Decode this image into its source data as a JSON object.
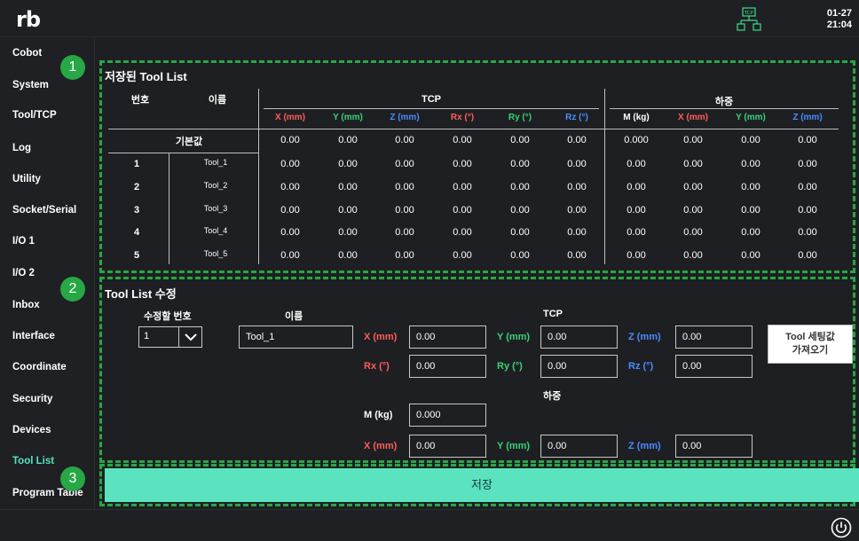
{
  "header": {
    "logo": "rb",
    "date": "01-27",
    "time": "21:04",
    "tcp_icon_label": "TCP"
  },
  "sidebar": {
    "items": [
      {
        "label": "Cobot"
      },
      {
        "label": "System"
      },
      {
        "label": "Tool/TCP"
      },
      {
        "label": "Log"
      },
      {
        "label": "Utility"
      },
      {
        "label": "Socket/Serial"
      },
      {
        "label": "I/O 1"
      },
      {
        "label": "I/O 2"
      },
      {
        "label": "Inbox"
      },
      {
        "label": "Interface"
      },
      {
        "label": "Coordinate"
      },
      {
        "label": "Security"
      },
      {
        "label": "Devices"
      },
      {
        "label": "Tool List",
        "active": true
      },
      {
        "label": "Program Table"
      }
    ]
  },
  "badges": [
    "1",
    "2",
    "3"
  ],
  "saved_list": {
    "title": "저장된 Tool List",
    "col_number": "번호",
    "col_name": "이름",
    "group_tcp": "TCP",
    "group_payload": "하중",
    "tcp_cols": [
      "X (mm)",
      "Y (mm)",
      "Z (mm)",
      "Rx (°)",
      "Ry (°)",
      "Rz (°)"
    ],
    "payload_cols": [
      "M (kg)",
      "X (mm)",
      "Y (mm)",
      "Z (mm)"
    ],
    "default_label": "기본값",
    "default_values": [
      "0.00",
      "0.00",
      "0.00",
      "0.00",
      "0.00",
      "0.00",
      "0.000",
      "0.00",
      "0.00",
      "0.00"
    ],
    "rows": [
      {
        "num": "1",
        "name": "Tool_1",
        "values": [
          "0.00",
          "0.00",
          "0.00",
          "0.00",
          "0.00",
          "0.00",
          "0.00",
          "0.00",
          "0.00",
          "0.00"
        ]
      },
      {
        "num": "2",
        "name": "Tool_2",
        "values": [
          "0.00",
          "0.00",
          "0.00",
          "0.00",
          "0.00",
          "0.00",
          "0.00",
          "0.00",
          "0.00",
          "0.00"
        ]
      },
      {
        "num": "3",
        "name": "Tool_3",
        "values": [
          "0.00",
          "0.00",
          "0.00",
          "0.00",
          "0.00",
          "0.00",
          "0.00",
          "0.00",
          "0.00",
          "0.00"
        ]
      },
      {
        "num": "4",
        "name": "Tool_4",
        "values": [
          "0.00",
          "0.00",
          "0.00",
          "0.00",
          "0.00",
          "0.00",
          "0.00",
          "0.00",
          "0.00",
          "0.00"
        ]
      },
      {
        "num": "5",
        "name": "Tool_5",
        "values": [
          "0.00",
          "0.00",
          "0.00",
          "0.00",
          "0.00",
          "0.00",
          "0.00",
          "0.00",
          "0.00",
          "0.00"
        ]
      }
    ]
  },
  "edit": {
    "title": "Tool List 수정",
    "number_label": "수정할 번호",
    "number_value": "1",
    "name_label": "이름",
    "name_value": "Tool_1",
    "tcp_label": "TCP",
    "payload_label": "하중",
    "x_label": "X (mm)",
    "x_value": "0.00",
    "y_label": "Y (mm)",
    "y_value": "0.00",
    "z_label": "Z (mm)",
    "z_value": "0.00",
    "rx_label": "Rx (°)",
    "rx_value": "0.00",
    "ry_label": "Ry (°)",
    "ry_value": "0.00",
    "rz_label": "Rz (°)",
    "rz_value": "0.00",
    "m_label": "M (kg)",
    "m_value": "0.000",
    "px_label": "X (mm)",
    "px_value": "0.00",
    "py_label": "Y (mm)",
    "py_value": "0.00",
    "pz_label": "Z (mm)",
    "pz_value": "0.00",
    "fetch_button_line1": "Tool 세팅값",
    "fetch_button_line2": "가져오기"
  },
  "save_button": "저장",
  "colors": {
    "background": "#1e1f22",
    "accent": "#5be3c0",
    "dash": "#27a745",
    "x_red": "#ff5d5d",
    "y_green": "#39d27a",
    "z_blue": "#4a8cff"
  }
}
